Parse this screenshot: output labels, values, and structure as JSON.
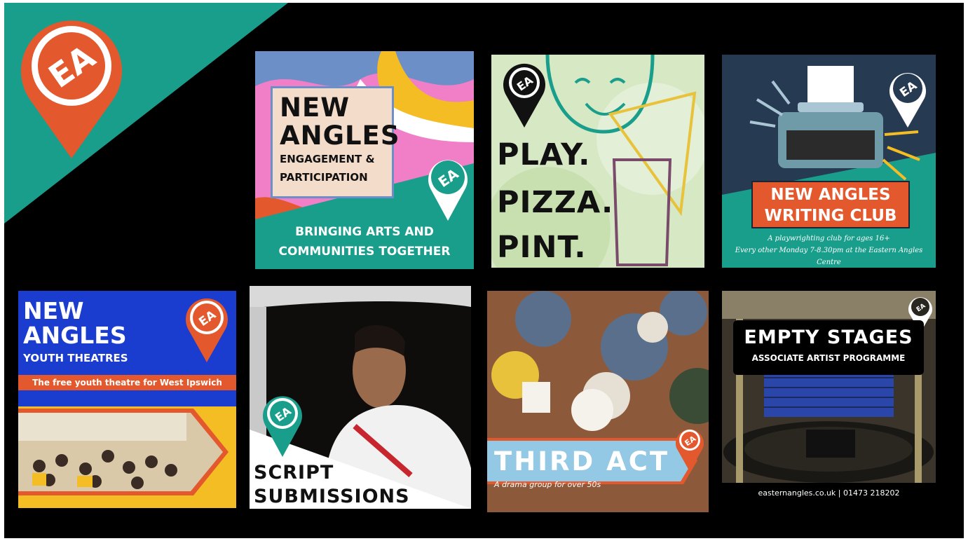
{
  "colors": {
    "teal": "#1a9e8c",
    "orange": "#e3582d",
    "navy": "#263a52",
    "blue": "#1a3ccf",
    "yellow": "#f3bd23",
    "light_blue": "#93c9e4"
  },
  "tiles": {
    "engagement": {
      "title_1": "NEW",
      "title_2": "ANGLES",
      "subtitle_1": "ENGAGEMENT &",
      "subtitle_2": "PARTICIPATION",
      "tagline_1": "BRINGING ARTS AND",
      "tagline_2": "COMMUNITIES TOGETHER"
    },
    "play_pizza_pint": {
      "line_1": "PLAY.",
      "line_2": "PIZZA.",
      "line_3": "PINT."
    },
    "writing_club": {
      "title_1": "NEW ANGLES",
      "title_2": "WRITING CLUB",
      "subtitle_1": "A playwrighting club for ages 16+",
      "subtitle_2": "Every other Monday 7-8.30pm at the Eastern Angles Centre"
    },
    "youth_theatres": {
      "title_1": "NEW",
      "title_2": "ANGLES",
      "subtitle": "YOUTH THEATRES",
      "banner": "The free youth theatre for West Ipswich"
    },
    "script_submissions": {
      "line_1": "SCRIPT",
      "line_2": "SUBMISSIONS"
    },
    "third_act": {
      "title": "THIRD ACT",
      "subtitle": "A drama group for over 50s"
    },
    "empty_stages": {
      "title": "EMPTY STAGES",
      "subtitle": "ASSOCIATE ARTIST PROGRAMME",
      "footer": "easternangles.co.uk | 01473 218202"
    }
  },
  "icons": {
    "logo": "ea-location-pin-icon"
  }
}
